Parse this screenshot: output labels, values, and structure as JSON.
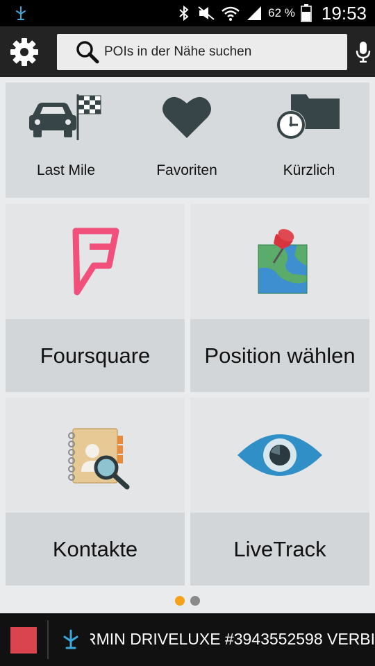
{
  "status_bar": {
    "battery_percent": "62 %",
    "time": "19:53",
    "icons": [
      "garmin-link-icon",
      "bluetooth-icon",
      "mute-icon",
      "wifi-icon",
      "signal-icon",
      "battery-icon"
    ]
  },
  "topbar": {
    "search_placeholder": "POIs in der Nähe suchen",
    "icons": [
      "gear-icon",
      "search-icon",
      "microphone-icon"
    ]
  },
  "quick_row": [
    {
      "label": "Last Mile",
      "icon": "car-flag-icon"
    },
    {
      "label": "Favoriten",
      "icon": "heart-icon"
    },
    {
      "label": "Kürzlich",
      "icon": "clock-folder-icon"
    }
  ],
  "tiles": [
    {
      "label": "Foursquare",
      "icon": "foursquare-icon"
    },
    {
      "label": "Position wählen",
      "icon": "map-pin-icon"
    },
    {
      "label": "Kontakte",
      "icon": "contacts-icon"
    },
    {
      "label": "LiveTrack",
      "icon": "eye-icon"
    }
  ],
  "pager": {
    "pages": 2,
    "active": 1
  },
  "bottom_bar": {
    "ticker_text": "RMIN DRIVELUXE #3943552598 VERBI"
  },
  "colors": {
    "accent_dot": "#f4a21c",
    "inactive_dot": "#8a8a8a",
    "stop_red": "#d9444e",
    "foursquare_pink": "#f0507a",
    "icon_dark": "#384548"
  }
}
